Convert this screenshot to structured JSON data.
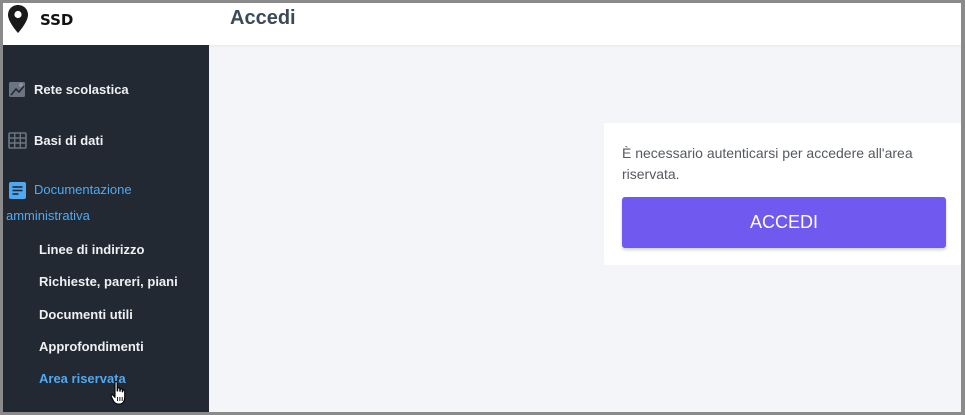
{
  "app": {
    "logo_text": "SSD",
    "logo_icon": "map-pin-icon"
  },
  "header": {
    "title": "Accedi"
  },
  "sidebar": {
    "items": [
      {
        "label": "Rete scolastica",
        "icon": "map-icon"
      },
      {
        "label": "Basi di dati",
        "icon": "table-grid-icon"
      },
      {
        "label_line1": "Documentazione",
        "label_line2": "amministrativa",
        "icon": "document-icon",
        "active": true
      }
    ],
    "subitems": [
      {
        "label": "Linee di indirizzo"
      },
      {
        "label": "Richieste, pareri, piani"
      },
      {
        "label": "Documenti utili"
      },
      {
        "label": "Approfondimenti"
      },
      {
        "label": "Area riservata",
        "active": true
      }
    ]
  },
  "main": {
    "message": "È necessario autenticarsi per accedere all'area riservata.",
    "button_label": "ACCEDI"
  },
  "colors": {
    "sidebar_bg": "#232932",
    "accent_link": "#4fa9f2",
    "button_bg": "#7059ef",
    "content_bg": "#f4f5f9"
  }
}
